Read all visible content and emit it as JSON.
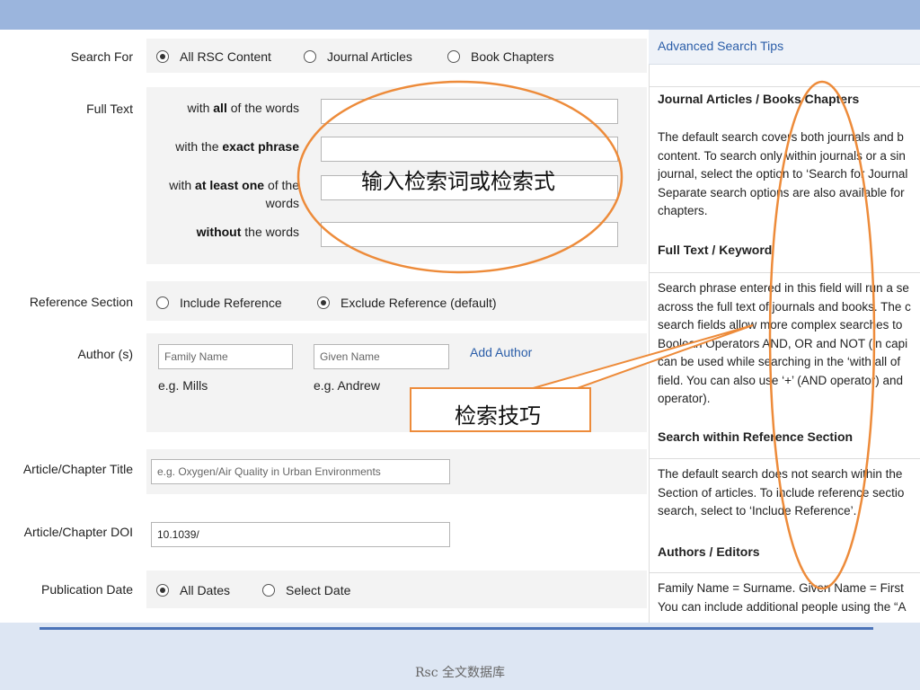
{
  "form": {
    "search_for": {
      "label": "Search For",
      "options": [
        "All RSC Content",
        "Journal Articles",
        "Book Chapters"
      ],
      "selected": "All RSC Content"
    },
    "full_text": {
      "label": "Full Text",
      "row1_pre": "with ",
      "row1_bold": "all",
      "row1_post": " of the words",
      "row2_pre": "with the ",
      "row2_bold": "exact phrase",
      "row3_pre": "with ",
      "row3_bold": "at least one",
      "row3_post": " of the",
      "row3_line2": "words",
      "row4_bold": "without",
      "row4_post": " the words"
    },
    "reference_section": {
      "label": "Reference Section",
      "options": [
        "Include Reference",
        "Exclude Reference (default)"
      ],
      "selected": "Exclude Reference (default)"
    },
    "author": {
      "label": "Author (s)",
      "family_placeholder": "Family Name",
      "given_placeholder": "Given Name",
      "add_author": "Add Author",
      "family_example": "e.g. Mills",
      "given_example": "e.g. Andrew"
    },
    "title": {
      "label": "Article/Chapter Title",
      "placeholder": "e.g. Oxygen/Air Quality in Urban Environments"
    },
    "doi": {
      "label": "Article/Chapter DOI",
      "value": "10.1039/"
    },
    "publication_date": {
      "label": "Publication Date",
      "options": [
        "All Dates",
        "Select Date"
      ],
      "selected": "All Dates"
    }
  },
  "tips": {
    "header": "Advanced Search Tips",
    "sections": [
      {
        "title": "Journal Articles / Books Chapters",
        "text": "The default search covers both journals and b\ncontent. To search only within journals or a sin\njournal, select the option to ‘Search for Journal\nSeparate search options are also available for\nchapters."
      },
      {
        "title": "Full Text / Keyword",
        "text": "Search phrase entered in this field will run a se\nacross the full text of journals and books. The c\nsearch fields allow more complex searches to\nBoolean Operators AND, OR and NOT (in capi\ncan be used while searching in the ‘with all of\nfield. You can also use ‘+’ (AND operator) and\noperator)."
      },
      {
        "title": "Search within Reference Section",
        "text": "The default search does not search within the\nSection of articles. To include reference sectio\nsearch, select to ‘Include Reference’."
      },
      {
        "title": "Authors / Editors",
        "text": "Family Name = Surname. Given Name = First\nYou can include additional people using the “A"
      }
    ]
  },
  "annotations": {
    "ellipse_text": "输入检索词或检索式",
    "box_text": "检索技巧",
    "color": "#ed8b3a"
  },
  "footer": "Rsc 全文数据库"
}
